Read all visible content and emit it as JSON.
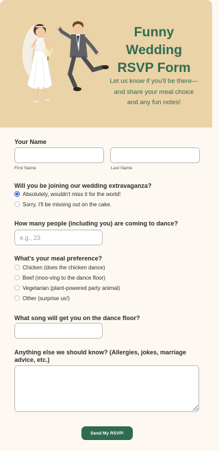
{
  "header": {
    "title": "Funny Wedding RSVP Form",
    "subtitle": "Let us know if you'll be there—and share your meal choice and any fun notes!"
  },
  "name_section": {
    "label": "Your Name",
    "first_label": "First Name",
    "last_label": "Last Name",
    "first_value": "",
    "last_value": ""
  },
  "attendance": {
    "label": "Will you be joining our wedding extravaganza?",
    "options": [
      "Absolutely, wouldn't miss it for the world!",
      "Sorry, I'll be missing out on the cake."
    ],
    "selected_index": 0
  },
  "guests": {
    "label": "How many people (including you) are coming to dance?",
    "placeholder": "e.g., 23",
    "value": ""
  },
  "meal": {
    "label": "What's your meal preference?",
    "options": [
      "Chicken (does the chicken dance)",
      "Beef (moo-ving to the dance floor)",
      "Vegetarian (plant-powered party animal)",
      "Other (surprise us!)"
    ]
  },
  "song": {
    "label": "What song will get you on the dance floor?",
    "value": ""
  },
  "notes": {
    "label": "Anything else we should know? (Allergies, jokes, marriage advice, etc.)",
    "value": ""
  },
  "submit": {
    "label": "Send My RSVP!"
  },
  "colors": {
    "hero_bg": "#ead3a6",
    "accent": "#2f6b52",
    "page_bg": "#fdf8f2",
    "radio_selected": "#2f63d9"
  },
  "illustration": {
    "name": "wedding-couple-illustration"
  }
}
